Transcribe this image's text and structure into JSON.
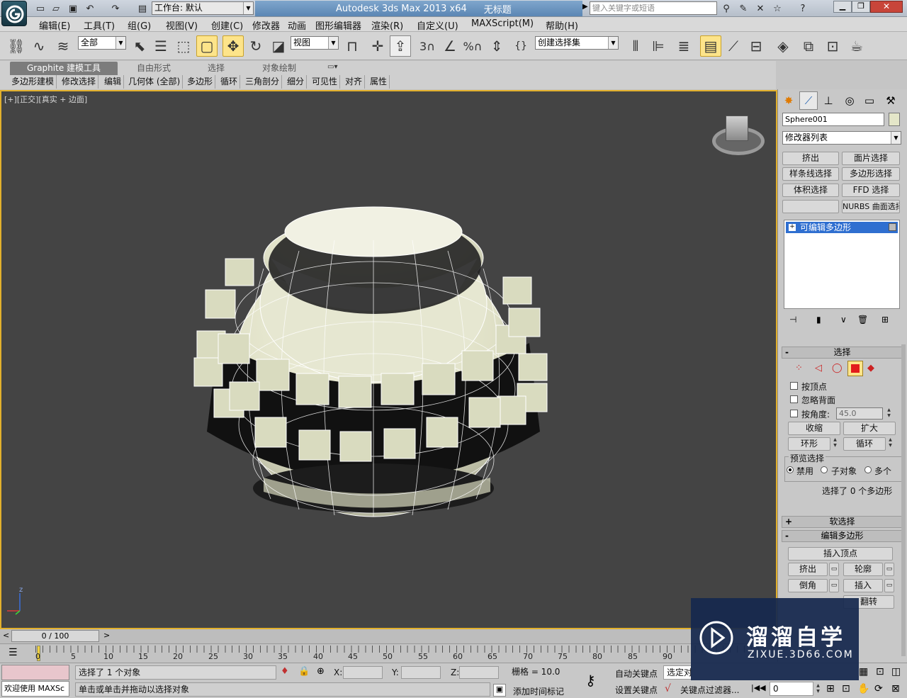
{
  "title_bar": {
    "workspace_label": "工作台: 默认",
    "app_title": "Autodesk 3ds Max  2013 x64",
    "doc_title": "无标题",
    "search_placeholder": "键入关键字或短语"
  },
  "menu": [
    "编辑(E)",
    "工具(T)",
    "组(G)",
    "视图(V)",
    "创建(C)",
    "修改器",
    "动画",
    "图形编辑器",
    "渲染(R)",
    "自定义(U)",
    "MAXScript(M)",
    "帮助(H)"
  ],
  "toolbar": {
    "selection_filter": "全部",
    "ref_coord": "视图",
    "named_selection": "创建选择集",
    "snap_3": "3",
    "pct": "%"
  },
  "ribbon": {
    "tabs": [
      "Graphite 建模工具",
      "自由形式",
      "选择",
      "对象绘制"
    ],
    "subtabs": [
      "多边形建模",
      "修改选择",
      "编辑",
      "几何体 (全部)",
      "多边形",
      "循环",
      "三角剖分",
      "细分",
      "可见性",
      "对齐",
      "属性"
    ]
  },
  "viewport": {
    "label_plus": "[+]",
    "label_view": "[正交]",
    "label_shading": "[真实 + 边面]",
    "axis_z": "z",
    "colors": {
      "mesh": "#dfe0c6",
      "border": "#e2b02c",
      "bg": "#444444"
    }
  },
  "command_panel": {
    "object_name": "Sphere001",
    "modifier_list": "修改器列表",
    "mod_buttons": [
      "挤出",
      "面片选择",
      "样条线选择",
      "多边形选择",
      "体积选择",
      "FFD 选择",
      "",
      "NURBS 曲面选择"
    ],
    "stack_item": "可编辑多边形",
    "selection_rollout": {
      "header": "选择",
      "by_vertex": "按顶点",
      "ignore_back": "忽略背面",
      "by_angle": "按角度:",
      "angle_value": "45.0",
      "shrink": "收缩",
      "grow": "扩大",
      "ring": "环形",
      "loop": "循环",
      "preview_label": "预览选择",
      "preview_opts": [
        "禁用",
        "子对象",
        "多个"
      ],
      "status": "选择了 0 个多边形"
    },
    "soft_selection": "软选择",
    "edit_polygons": {
      "header": "编辑多边形",
      "insert_vertex": "插入顶点",
      "extrude": "挤出",
      "outline": "轮廓",
      "bevel": "倒角",
      "inset": "插入",
      "flip": "翻转"
    }
  },
  "timeline": {
    "frame_display": "0 / 100",
    "ticks": [
      "0",
      "5",
      "10",
      "15",
      "20",
      "25",
      "30",
      "35",
      "40",
      "45",
      "50",
      "55",
      "60",
      "65",
      "70",
      "75",
      "80",
      "85",
      "90"
    ]
  },
  "status": {
    "maxscript": "欢迎使用 MAXSc",
    "selected": "选择了 1 个对象",
    "prompt": "单击或单击并拖动以选择对象",
    "x_label": "X:",
    "y_label": "Y:",
    "z_label": "Z:",
    "grid": "栅格 = 10.0",
    "add_time_tag": "添加时间标记",
    "auto_key": "自动关键点",
    "set_key": "设置关键点",
    "selected_obj": "选定对",
    "key_filters": "关键点过滤器...",
    "frame_value": "0"
  },
  "watermark": {
    "brand": "溜溜自学",
    "url": "ZIXUE.3D66.COM"
  }
}
